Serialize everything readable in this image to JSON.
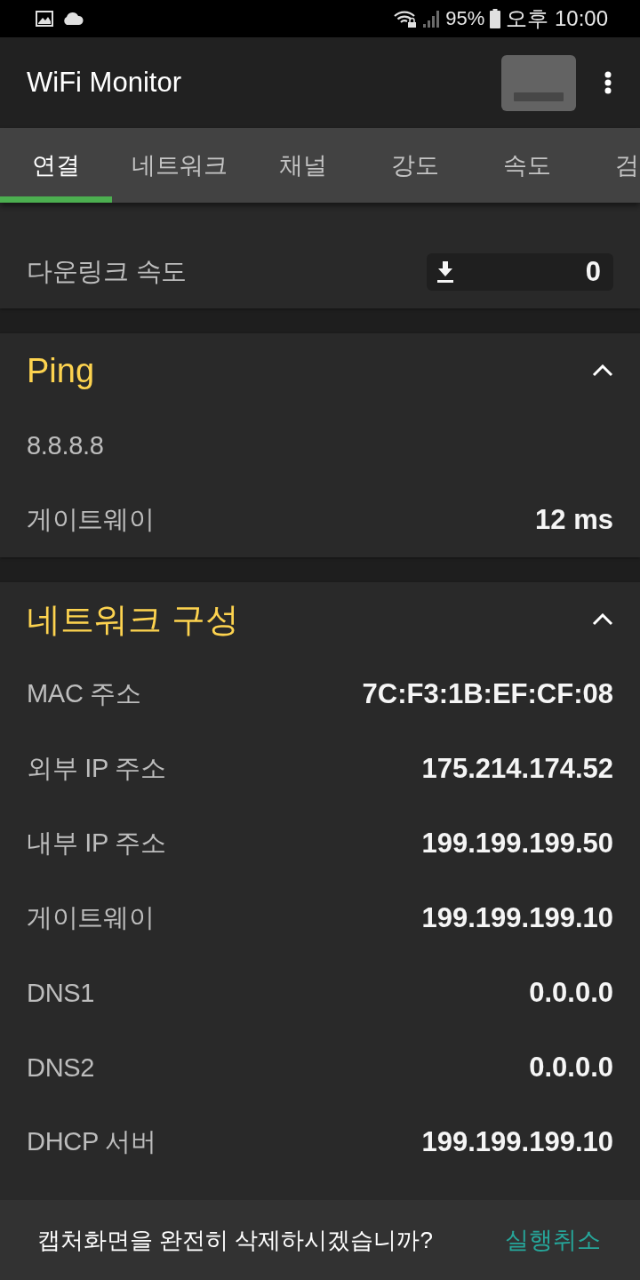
{
  "status_bar": {
    "battery": "95%",
    "time": "오후 10:00"
  },
  "app_bar": {
    "title": "WiFi Monitor"
  },
  "tabs": [
    {
      "label": "연결",
      "selected": true
    },
    {
      "label": "네트워크",
      "selected": false
    },
    {
      "label": "채널",
      "selected": false
    },
    {
      "label": "강도",
      "selected": false
    },
    {
      "label": "속도",
      "selected": false
    },
    {
      "label": "검",
      "selected": false
    }
  ],
  "speed_card": {
    "rows": [
      {
        "kind": "download",
        "label": "다운링크 속도",
        "value": "0"
      }
    ]
  },
  "sections": [
    {
      "title": "Ping",
      "expanded": true,
      "rows": [
        {
          "label": "8.8.8.8"
        },
        {
          "label": "게이트웨이",
          "value": "12 ms"
        }
      ]
    },
    {
      "title": "네트워크 구성",
      "expanded": true,
      "rows": [
        {
          "label": "MAC 주소",
          "value": "7C:F3:1B:EF:CF:08"
        },
        {
          "label": "외부 IP 주소",
          "value": "175.214.174.52"
        },
        {
          "label": "내부 IP 주소",
          "value": "199.199.199.50"
        },
        {
          "label": "게이트웨이",
          "value": "199.199.199.10"
        },
        {
          "label": "DNS1",
          "value": "0.0.0.0"
        },
        {
          "label": "DNS2",
          "value": "0.0.0.0"
        },
        {
          "label": "DHCP 서버",
          "value": "199.199.199.10"
        }
      ]
    }
  ],
  "snackbar": {
    "message": "캡처화면을 완전히 삭제하시겠습니까?",
    "action": "실행취소"
  }
}
